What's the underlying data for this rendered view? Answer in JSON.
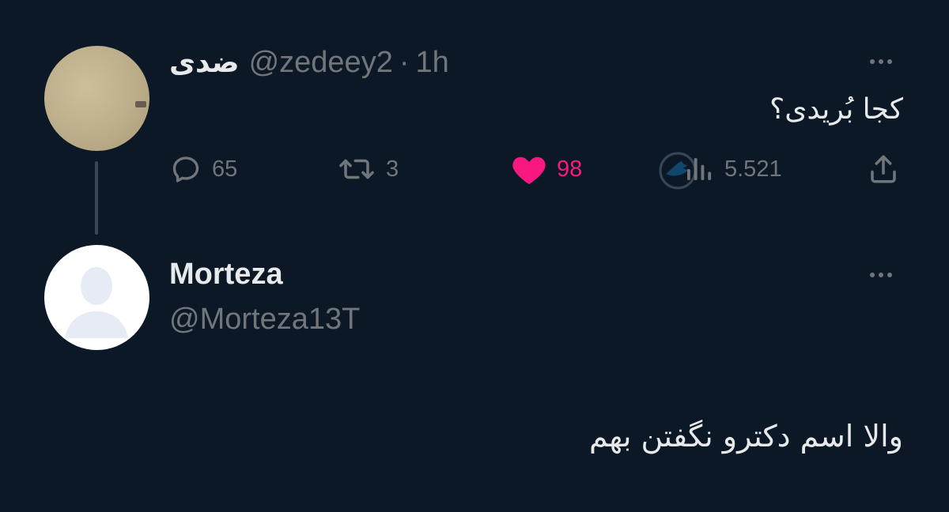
{
  "colors": {
    "background": "#0c1826",
    "text_primary": "#e7e9ea",
    "text_secondary": "#71767b",
    "like_pink": "#f91880"
  },
  "parent_tweet": {
    "display_name": "ضدی",
    "handle": "@zedeey2",
    "separator": "·",
    "time": "1h",
    "text": "کجا بُریدی؟",
    "actions": {
      "reply": {
        "icon": "reply-icon",
        "count": "65"
      },
      "retweet": {
        "icon": "retweet-icon",
        "count": "3"
      },
      "like": {
        "icon": "heart-icon",
        "count": "98",
        "liked": true
      },
      "views": {
        "icon": "views-icon",
        "count": "5.521"
      },
      "share": {
        "icon": "share-icon"
      }
    }
  },
  "reply_tweet": {
    "display_name": "Morteza",
    "handle": "@Morteza13T",
    "text": "والا اسم دکترو نگفتن بهم"
  }
}
